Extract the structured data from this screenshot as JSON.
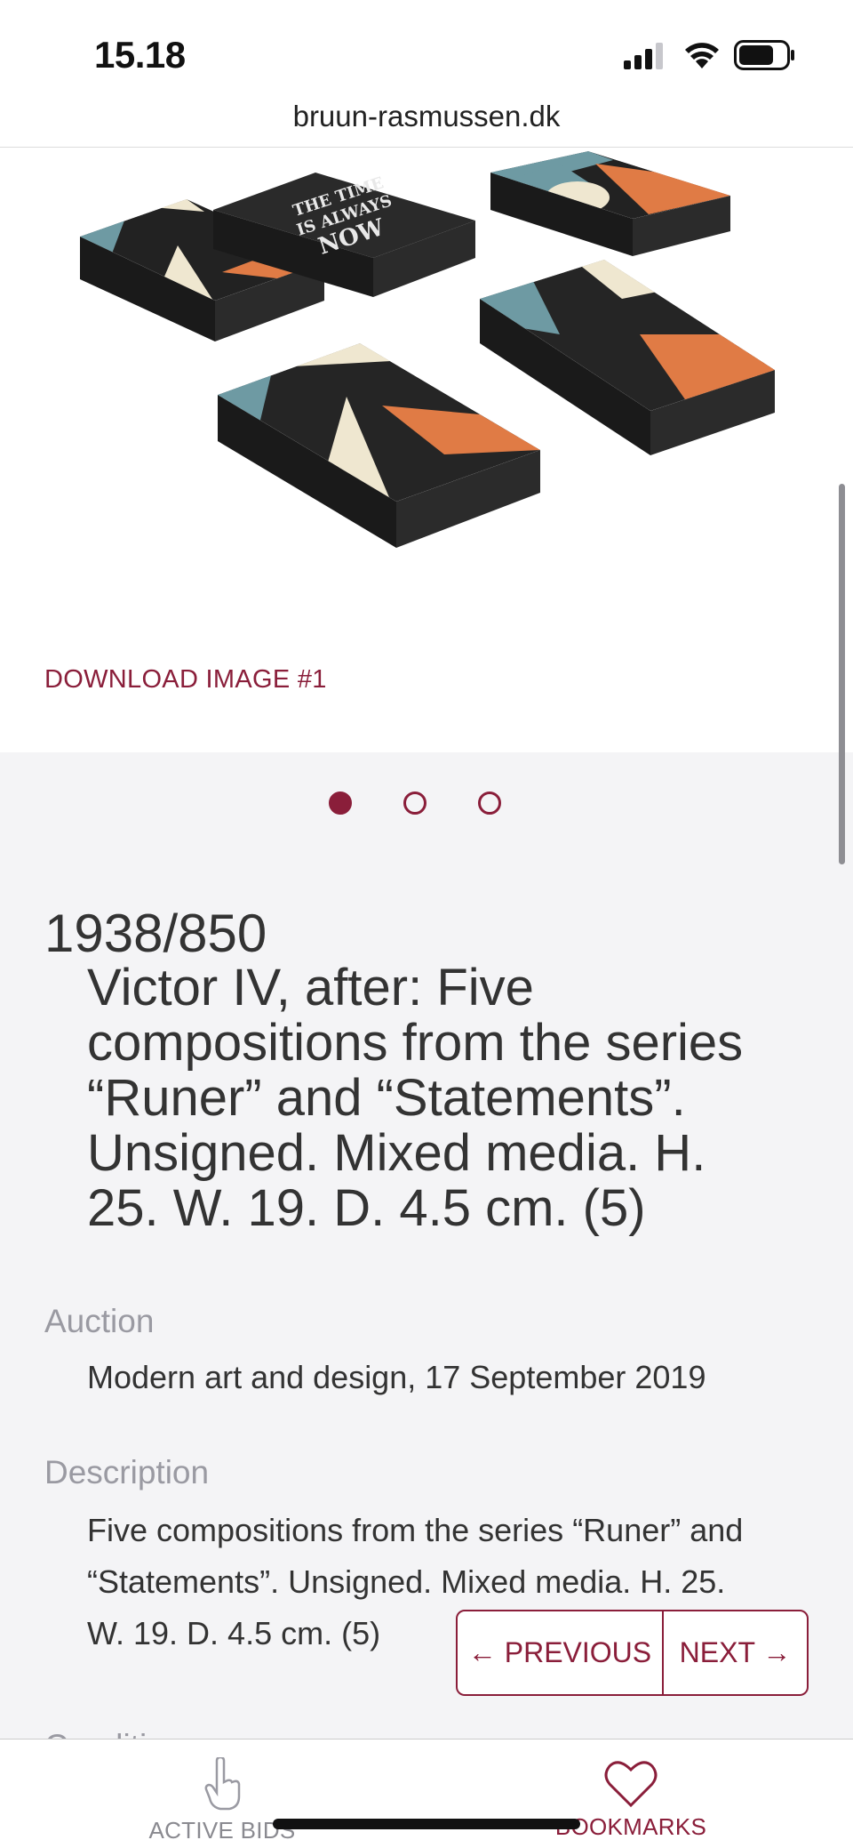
{
  "status_bar": {
    "time": "15.18"
  },
  "browser": {
    "url": "bruun-rasmussen.dk"
  },
  "gallery": {
    "artwork_text": [
      "THE TIME",
      "IS ALWAYS",
      "NOW"
    ],
    "download_label": "DOWNLOAD IMAGE #1",
    "dots_total": 3,
    "dot_active_index": 0
  },
  "lot": {
    "number": "1938/850",
    "title": "Victor IV, after: Five compositions from the series “Runer” and “Statements”. Unsigned. Mixed media. H. 25. W. 19. D. 4.5 cm. (5)",
    "title_lines": [
      "Victor IV, after: Five",
      "compositions from the series",
      "“Runer” and “Statements”.",
      "Unsigned. Mixed media. H.",
      "25. W. 19. D. 4.5 cm. (5)"
    ]
  },
  "sections": {
    "auction_label": "Auction",
    "auction_value": "Modern art and design, 17 September 2019",
    "description_label": "Description",
    "description_lines": [
      "Five compositions from the series “Runer” and",
      "“Statements”. Unsigned. Mixed media. H. 25.",
      "W. 19. D. 4.5 cm. (5)"
    ],
    "next_label_partial": "Condition"
  },
  "pager": {
    "previous_label": "← PREVIOUS",
    "next_label": "NEXT →"
  },
  "tab_bar": {
    "active_bids_label": "ACTIVE BIDS",
    "bookmarks_label": "BOOKMARKS"
  },
  "colors": {
    "accent": "#8a1e3a",
    "page_bg": "#f4f4f6",
    "muted_text": "#9a9aa2"
  }
}
